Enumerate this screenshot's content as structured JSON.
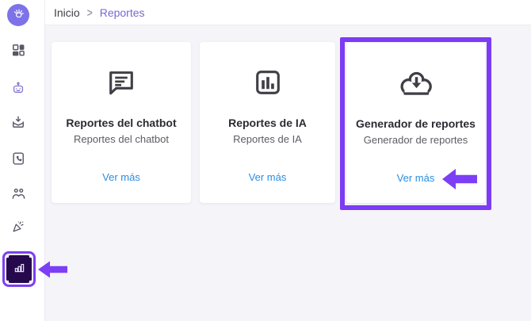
{
  "breadcrumb": {
    "items": [
      "Inicio",
      "Reportes"
    ],
    "separator": ">"
  },
  "sidebar": {
    "logo_icon": "hand-logo-icon",
    "items": [
      {
        "icon": "dashboard-icon",
        "active": false
      },
      {
        "icon": "chatbot-robot-icon",
        "active": false
      },
      {
        "icon": "inbox-download-icon",
        "active": false
      },
      {
        "icon": "contacts-phonebook-icon",
        "active": false
      },
      {
        "icon": "team-people-icon",
        "active": false
      },
      {
        "icon": "campaign-megaphone-icon",
        "active": false
      },
      {
        "icon": "reports-bar-chart-icon",
        "active": true
      }
    ]
  },
  "cards": [
    {
      "icon": "chat-bubble-icon",
      "title": "Reportes del chatbot",
      "subtitle": "Reportes del chatbot",
      "link_label": "Ver más"
    },
    {
      "icon": "bar-chart-square-icon",
      "title": "Reportes de IA",
      "subtitle": "Reportes de IA",
      "link_label": "Ver más"
    },
    {
      "icon": "cloud-download-icon",
      "title": "Generador de reportes",
      "subtitle": "Generador de reportes",
      "link_label": "Ver más",
      "highlighted": true
    }
  ],
  "annotations": {
    "highlight_box_target": "Generador de reportes card",
    "arrow_targets": [
      "sidebar-reports-item",
      "generador-ver-mas-link"
    ],
    "color": "#7c3bf5"
  },
  "colors": {
    "accent_purple": "#7c3ff2",
    "annotation_purple": "#7c3bf5",
    "logo_purple": "#7e72e8",
    "active_item_bg": "#26084d",
    "link_blue": "#2b8de0",
    "breadcrumb_current": "#7668d2",
    "main_bg": "#f4f4f9"
  }
}
